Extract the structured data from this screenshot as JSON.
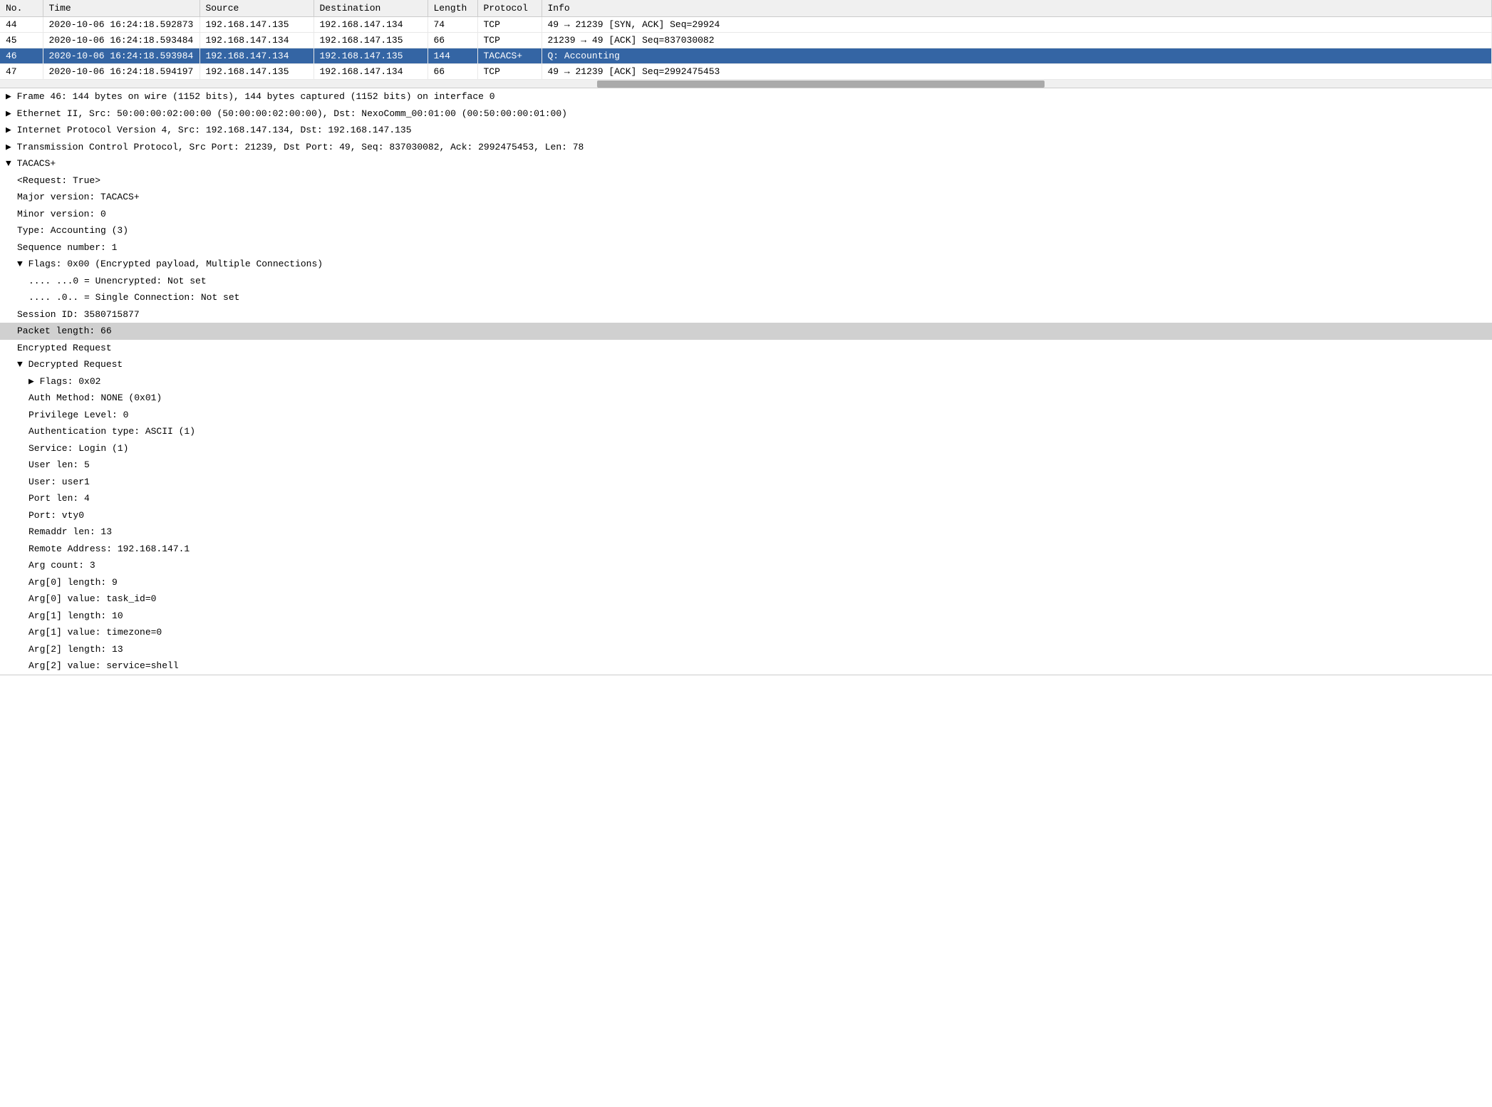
{
  "table": {
    "columns": [
      "No.",
      "Time",
      "Source",
      "Destination",
      "Length",
      "Protocol",
      "Info"
    ],
    "rows": [
      {
        "no": "44",
        "time": "2020-10-06 16:24:18.592873",
        "source": "192.168.147.135",
        "destination": "192.168.147.134",
        "length": "74",
        "protocol": "TCP",
        "info": "49 → 21239 [SYN, ACK] Seq=29924",
        "selected": false
      },
      {
        "no": "45",
        "time": "2020-10-06 16:24:18.593484",
        "source": "192.168.147.134",
        "destination": "192.168.147.135",
        "length": "66",
        "protocol": "TCP",
        "info": "21239 → 49 [ACK] Seq=837030082",
        "selected": false
      },
      {
        "no": "46",
        "time": "2020-10-06 16:24:18.593984",
        "source": "192.168.147.134",
        "destination": "192.168.147.135",
        "length": "144",
        "protocol": "TACACS+",
        "info": "Q: Accounting",
        "selected": true
      },
      {
        "no": "47",
        "time": "2020-10-06 16:24:18.594197",
        "source": "192.168.147.135",
        "destination": "192.168.147.134",
        "length": "66",
        "protocol": "TCP",
        "info": "49 → 21239 [ACK] Seq=2992475453",
        "selected": false
      }
    ]
  },
  "detail": {
    "lines": [
      {
        "indent": 0,
        "expandable": true,
        "expanded": false,
        "text": "Frame 46: 144 bytes on wire (1152 bits), 144 bytes captured (1152 bits) on interface 0"
      },
      {
        "indent": 0,
        "expandable": true,
        "expanded": false,
        "text": "Ethernet II, Src: 50:00:00:02:00:00 (50:00:00:02:00:00), Dst: NexoComm_00:01:00 (00:50:00:00:01:00)"
      },
      {
        "indent": 0,
        "expandable": true,
        "expanded": false,
        "text": "Internet Protocol Version 4, Src: 192.168.147.134, Dst: 192.168.147.135"
      },
      {
        "indent": 0,
        "expandable": true,
        "expanded": false,
        "text": "Transmission Control Protocol, Src Port: 21239, Dst Port: 49, Seq: 837030082, Ack: 2992475453, Len: 78"
      },
      {
        "indent": 0,
        "expandable": true,
        "expanded": true,
        "text": "TACACS+"
      },
      {
        "indent": 1,
        "expandable": false,
        "expanded": false,
        "text": "<Request: True>"
      },
      {
        "indent": 1,
        "expandable": false,
        "expanded": false,
        "text": "Major version: TACACS+"
      },
      {
        "indent": 1,
        "expandable": false,
        "expanded": false,
        "text": "Minor version: 0"
      },
      {
        "indent": 1,
        "expandable": false,
        "expanded": false,
        "text": "Type: Accounting (3)"
      },
      {
        "indent": 1,
        "expandable": false,
        "expanded": false,
        "text": "Sequence number: 1"
      },
      {
        "indent": 1,
        "expandable": true,
        "expanded": true,
        "text": "Flags: 0x00 (Encrypted payload, Multiple Connections)"
      },
      {
        "indent": 2,
        "expandable": false,
        "expanded": false,
        "text": ".... ...0 = Unencrypted: Not set"
      },
      {
        "indent": 2,
        "expandable": false,
        "expanded": false,
        "text": ".... .0.. = Single Connection: Not set"
      },
      {
        "indent": 1,
        "expandable": false,
        "expanded": false,
        "text": "Session ID: 3580715877"
      },
      {
        "indent": 1,
        "expandable": false,
        "expanded": false,
        "text": "Packet length: 66",
        "highlighted": true
      },
      {
        "indent": 1,
        "expandable": false,
        "expanded": false,
        "text": "Encrypted Request"
      },
      {
        "indent": 1,
        "expandable": true,
        "expanded": true,
        "text": "Decrypted Request"
      },
      {
        "indent": 2,
        "expandable": true,
        "expanded": false,
        "text": "Flags: 0x02"
      },
      {
        "indent": 2,
        "expandable": false,
        "expanded": false,
        "text": "Auth Method: NONE (0x01)"
      },
      {
        "indent": 2,
        "expandable": false,
        "expanded": false,
        "text": "Privilege Level: 0"
      },
      {
        "indent": 2,
        "expandable": false,
        "expanded": false,
        "text": "Authentication type: ASCII (1)"
      },
      {
        "indent": 2,
        "expandable": false,
        "expanded": false,
        "text": "Service: Login (1)"
      },
      {
        "indent": 2,
        "expandable": false,
        "expanded": false,
        "text": "User len: 5"
      },
      {
        "indent": 2,
        "expandable": false,
        "expanded": false,
        "text": "User: user1"
      },
      {
        "indent": 2,
        "expandable": false,
        "expanded": false,
        "text": "Port len: 4"
      },
      {
        "indent": 2,
        "expandable": false,
        "expanded": false,
        "text": "Port: vty0"
      },
      {
        "indent": 2,
        "expandable": false,
        "expanded": false,
        "text": "Remaddr len: 13"
      },
      {
        "indent": 2,
        "expandable": false,
        "expanded": false,
        "text": "Remote Address: 192.168.147.1"
      },
      {
        "indent": 2,
        "expandable": false,
        "expanded": false,
        "text": "Arg count: 3"
      },
      {
        "indent": 2,
        "expandable": false,
        "expanded": false,
        "text": "Arg[0] length: 9"
      },
      {
        "indent": 2,
        "expandable": false,
        "expanded": false,
        "text": "Arg[0] value: task_id=0"
      },
      {
        "indent": 2,
        "expandable": false,
        "expanded": false,
        "text": "Arg[1] length: 10"
      },
      {
        "indent": 2,
        "expandable": false,
        "expanded": false,
        "text": "Arg[1] value: timezone=0"
      },
      {
        "indent": 2,
        "expandable": false,
        "expanded": false,
        "text": "Arg[2] length: 13"
      },
      {
        "indent": 2,
        "expandable": false,
        "expanded": false,
        "text": "Arg[2] value: service=shell"
      }
    ]
  }
}
